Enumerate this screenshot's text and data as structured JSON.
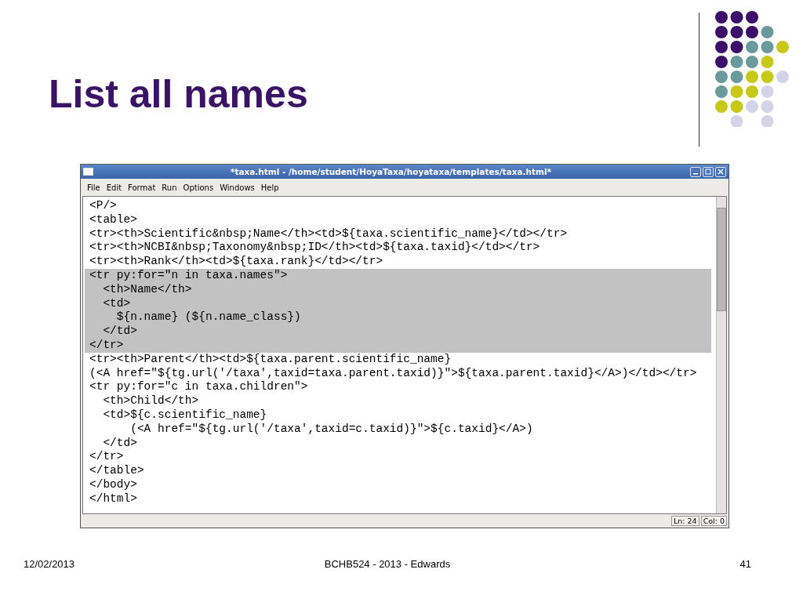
{
  "slide": {
    "title": "List all names"
  },
  "window": {
    "title": "*taxa.html - /home/student/HoyaTaxa/hoyataxa/templates/taxa.html*"
  },
  "menu": [
    "File",
    "Edit",
    "Format",
    "Run",
    "Options",
    "Windows",
    "Help"
  ],
  "code_lines": [
    {
      "text": "<P/>",
      "selected": false
    },
    {
      "text": "<table>",
      "selected": false
    },
    {
      "text": "<tr><th>Scientific&nbsp;Name</th><td>${taxa.scientific_name}</td></tr>",
      "selected": false
    },
    {
      "text": "<tr><th>NCBI&nbsp;Taxonomy&nbsp;ID</th><td>${taxa.taxid}</td></tr>",
      "selected": false
    },
    {
      "text": "<tr><th>Rank</th><td>${taxa.rank}</td></tr>",
      "selected": false
    },
    {
      "text": "<tr py:for=\"n in taxa.names\">",
      "selected": true
    },
    {
      "text": "  <th>Name</th>",
      "selected": true
    },
    {
      "text": "  <td>",
      "selected": true
    },
    {
      "text": "    ${n.name} (${n.name_class})",
      "selected": true
    },
    {
      "text": "  </td>",
      "selected": true
    },
    {
      "text": "</tr>",
      "selected": true
    },
    {
      "text": "<tr><th>Parent</th><td>${taxa.parent.scientific_name}",
      "selected": false
    },
    {
      "text": "(<A href=\"${tg.url('/taxa',taxid=taxa.parent.taxid)}\">${taxa.parent.taxid}</A>)</td></tr>",
      "selected": false
    },
    {
      "text": "<tr py:for=\"c in taxa.children\">",
      "selected": false
    },
    {
      "text": "  <th>Child</th>",
      "selected": false
    },
    {
      "text": "  <td>${c.scientific_name}",
      "selected": false
    },
    {
      "text": "      (<A href=\"${tg.url('/taxa',taxid=c.taxid)}\">${c.taxid}</A>)",
      "selected": false
    },
    {
      "text": "  </td>",
      "selected": false
    },
    {
      "text": "</tr>",
      "selected": false
    },
    {
      "text": "</table>",
      "selected": false
    },
    {
      "text": "</body>",
      "selected": false
    },
    {
      "text": "</html>",
      "selected": false
    }
  ],
  "status_bar": {
    "line": "Ln: 24",
    "column": "Col: 0"
  },
  "footer": {
    "date": "12/02/2013",
    "center": "BCHB524 - 2013 - Edwards",
    "page": "41"
  }
}
